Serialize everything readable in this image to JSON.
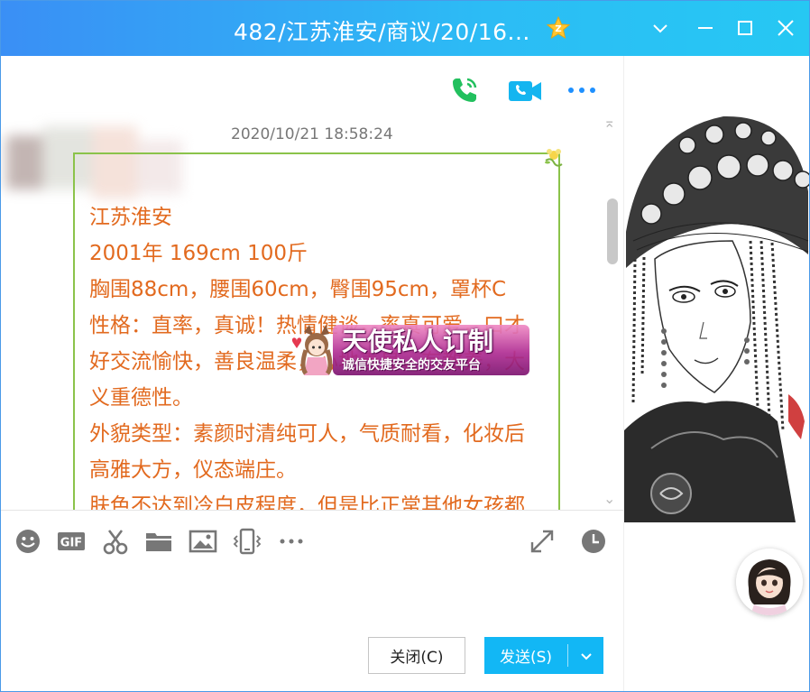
{
  "window": {
    "title": "482/江苏淮安/商议/20/16...",
    "title_badge_icon": "qq-vip-star-icon",
    "controls": [
      "chevron-down-icon",
      "restore-icon",
      "maximize-icon",
      "close-icon"
    ],
    "accent_color": "#12b7f5"
  },
  "chat": {
    "top_tools": [
      "phone-call-icon",
      "video-call-icon",
      "more-icon"
    ],
    "timestamp": "2020/10/21 18:58:24",
    "message_lines": [
      "江苏淮安",
      "2001年  169cm 100斤",
      "胸围88cm，腰围60cm，臀围95cm，罩杯C",
      "性格：直率，真诚！热情健谈，率真可爱，口才",
      "好交流愉快，善良温柔，心地善良，有教养，大",
      "义重德性。",
      "外貌类型：素颜时清纯可人，气质耐看，化妆后",
      "高雅大方，仪态端庄。",
      "肤色不达到冷白皮程度，但是比正常其他女孩都"
    ],
    "message_color": "#e26a1f",
    "watermark": {
      "main": "天使私人订制",
      "sub": "诚信快捷安全的交友平台"
    }
  },
  "input_toolbar": {
    "icons": [
      "emoji-icon",
      "gif-icon",
      "scissors-icon",
      "folder-icon",
      "image-icon",
      "shake-icon",
      "more-icon",
      "expand-icon",
      "history-clock-icon"
    ],
    "gif_text": "GIF"
  },
  "buttons": {
    "close_label": "关闭(C)",
    "send_label": "发送(S)"
  }
}
